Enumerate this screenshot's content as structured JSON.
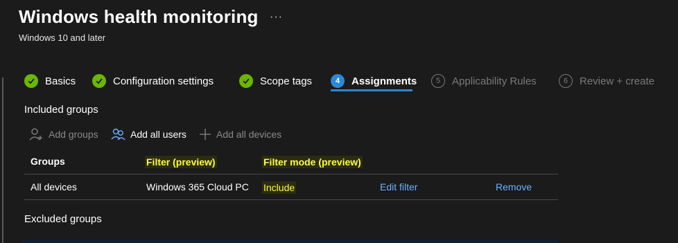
{
  "header": {
    "title": "Windows health monitoring",
    "more_label": "···",
    "subtitle": "Windows 10 and later"
  },
  "wizard": {
    "steps": [
      {
        "label": "Basics",
        "state": "done",
        "marker": "check-icon"
      },
      {
        "label": "Configuration settings",
        "state": "done",
        "marker": "check-icon"
      },
      {
        "label": "Scope tags",
        "state": "done",
        "marker": "check-icon"
      },
      {
        "label": "Assignments",
        "state": "active",
        "marker": "4"
      },
      {
        "label": "Applicability Rules",
        "state": "future",
        "marker": "5"
      },
      {
        "label": "Review + create",
        "state": "future",
        "marker": "6"
      }
    ]
  },
  "included": {
    "heading": "Included groups",
    "toolbar": {
      "add_groups": "Add groups",
      "add_all_users": "Add all users",
      "add_all_devices": "Add all devices"
    },
    "table": {
      "columns": [
        "Groups",
        "Filter (preview)",
        "Filter mode (preview)"
      ],
      "rows": [
        {
          "group": "All devices",
          "filter": "Windows 365 Cloud PC",
          "mode": "Include",
          "edit": "Edit filter",
          "remove": "Remove"
        }
      ]
    }
  },
  "excluded": {
    "heading": "Excluded groups"
  },
  "colors": {
    "background": "#1b1b1b",
    "accent": "#2b88d8",
    "success": "#6bb700",
    "link": "#6cb0ff",
    "highlight_text": "#ffff3d"
  }
}
